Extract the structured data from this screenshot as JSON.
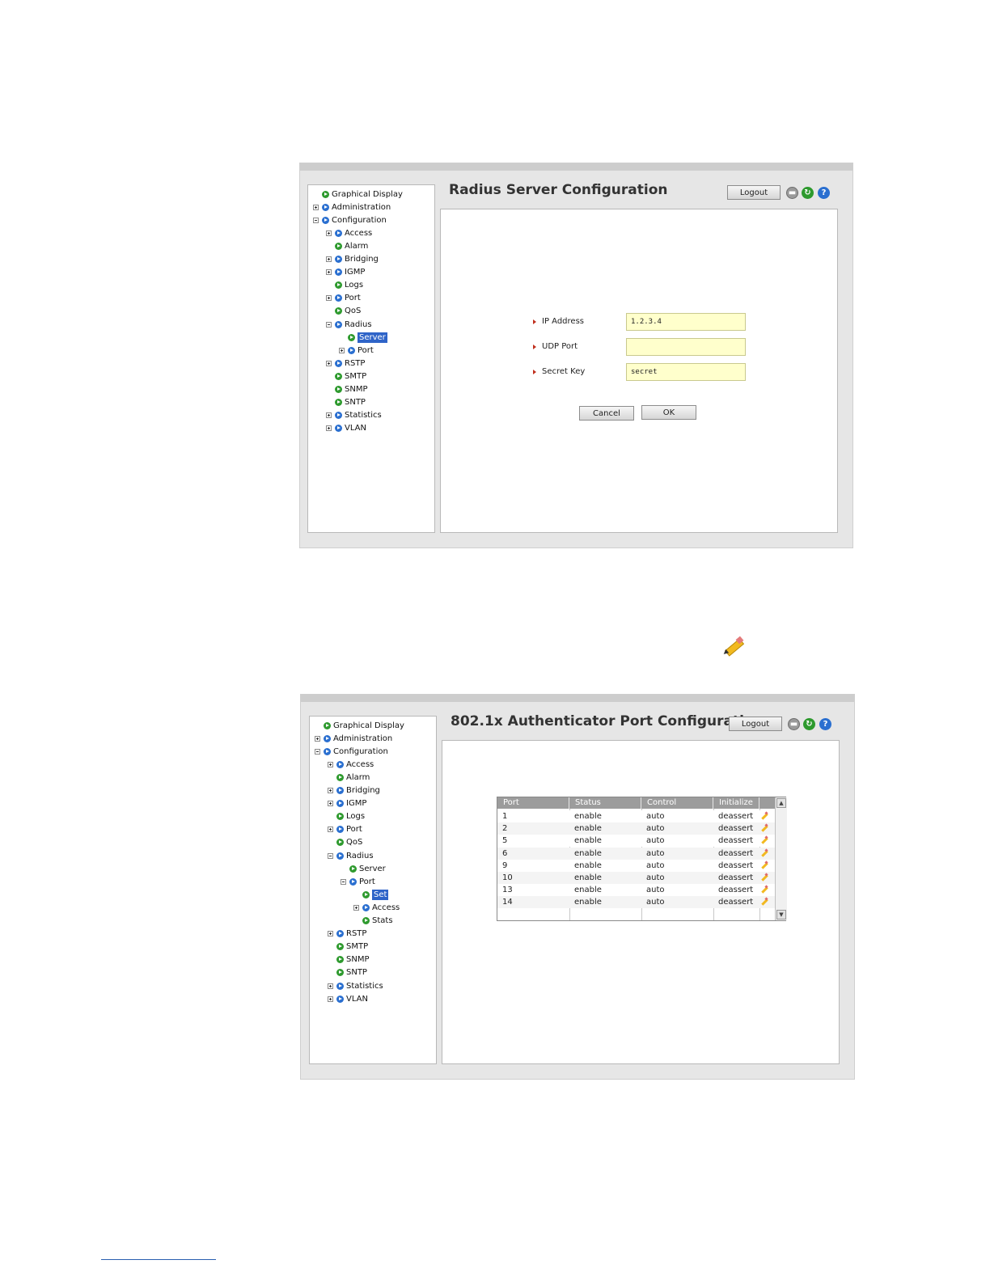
{
  "screen1": {
    "title": "Radius Server Configuration",
    "logout_label": "Logout",
    "tree": [
      {
        "label": "Graphical Display",
        "exp": "",
        "color": "green",
        "level": 0,
        "sel": false
      },
      {
        "label": "Administration",
        "exp": "plus",
        "color": "blue",
        "level": 0,
        "sel": false
      },
      {
        "label": "Configuration",
        "exp": "minus",
        "color": "blue",
        "level": 0,
        "sel": false
      },
      {
        "label": "Access",
        "exp": "plus",
        "color": "blue",
        "level": 1,
        "sel": false
      },
      {
        "label": "Alarm",
        "exp": "",
        "color": "green",
        "level": 1,
        "sel": false
      },
      {
        "label": "Bridging",
        "exp": "plus",
        "color": "blue",
        "level": 1,
        "sel": false
      },
      {
        "label": "IGMP",
        "exp": "plus",
        "color": "blue",
        "level": 1,
        "sel": false
      },
      {
        "label": "Logs",
        "exp": "",
        "color": "green",
        "level": 1,
        "sel": false
      },
      {
        "label": "Port",
        "exp": "plus",
        "color": "blue",
        "level": 1,
        "sel": false
      },
      {
        "label": "QoS",
        "exp": "",
        "color": "green",
        "level": 1,
        "sel": false
      },
      {
        "label": "Radius",
        "exp": "minus",
        "color": "blue",
        "level": 1,
        "sel": false
      },
      {
        "label": "Server",
        "exp": "",
        "color": "green",
        "level": 2,
        "sel": true
      },
      {
        "label": "Port",
        "exp": "plus",
        "color": "blue",
        "level": 2,
        "sel": false
      },
      {
        "label": "RSTP",
        "exp": "plus",
        "color": "blue",
        "level": 1,
        "sel": false
      },
      {
        "label": "SMTP",
        "exp": "",
        "color": "green",
        "level": 1,
        "sel": false
      },
      {
        "label": "SNMP",
        "exp": "",
        "color": "green",
        "level": 1,
        "sel": false
      },
      {
        "label": "SNTP",
        "exp": "",
        "color": "green",
        "level": 1,
        "sel": false
      },
      {
        "label": "Statistics",
        "exp": "plus",
        "color": "blue",
        "level": 1,
        "sel": false
      },
      {
        "label": "VLAN",
        "exp": "plus",
        "color": "blue",
        "level": 1,
        "sel": false
      }
    ],
    "form": {
      "ip_label": "IP Address",
      "ip_value": "1.2.3.4",
      "udp_label": "UDP Port",
      "udp_value": "",
      "key_label": "Secret Key",
      "key_value": "secret",
      "cancel_label": "Cancel",
      "ok_label": "OK"
    }
  },
  "screen2": {
    "title": "802.1x Authenticator Port Configuration",
    "logout_label": "Logout",
    "tree": [
      {
        "label": "Graphical Display",
        "exp": "",
        "color": "green",
        "level": 0,
        "sel": false
      },
      {
        "label": "Administration",
        "exp": "plus",
        "color": "blue",
        "level": 0,
        "sel": false
      },
      {
        "label": "Configuration",
        "exp": "minus",
        "color": "blue",
        "level": 0,
        "sel": false
      },
      {
        "label": "Access",
        "exp": "plus",
        "color": "blue",
        "level": 1,
        "sel": false
      },
      {
        "label": "Alarm",
        "exp": "",
        "color": "green",
        "level": 1,
        "sel": false
      },
      {
        "label": "Bridging",
        "exp": "plus",
        "color": "blue",
        "level": 1,
        "sel": false
      },
      {
        "label": "IGMP",
        "exp": "plus",
        "color": "blue",
        "level": 1,
        "sel": false
      },
      {
        "label": "Logs",
        "exp": "",
        "color": "green",
        "level": 1,
        "sel": false
      },
      {
        "label": "Port",
        "exp": "plus",
        "color": "blue",
        "level": 1,
        "sel": false
      },
      {
        "label": "QoS",
        "exp": "",
        "color": "green",
        "level": 1,
        "sel": false
      },
      {
        "label": "Radius",
        "exp": "minus",
        "color": "blue",
        "level": 1,
        "sel": false
      },
      {
        "label": "Server",
        "exp": "",
        "color": "green",
        "level": 2,
        "sel": false
      },
      {
        "label": "Port",
        "exp": "minus",
        "color": "blue",
        "level": 2,
        "sel": false
      },
      {
        "label": "Set",
        "exp": "",
        "color": "green",
        "level": 3,
        "sel": true
      },
      {
        "label": "Access",
        "exp": "plus",
        "color": "blue",
        "level": 3,
        "sel": false
      },
      {
        "label": "Stats",
        "exp": "",
        "color": "green",
        "level": 3,
        "sel": false
      },
      {
        "label": "RSTP",
        "exp": "plus",
        "color": "blue",
        "level": 1,
        "sel": false
      },
      {
        "label": "SMTP",
        "exp": "",
        "color": "green",
        "level": 1,
        "sel": false
      },
      {
        "label": "SNMP",
        "exp": "",
        "color": "green",
        "level": 1,
        "sel": false
      },
      {
        "label": "SNTP",
        "exp": "",
        "color": "green",
        "level": 1,
        "sel": false
      },
      {
        "label": "Statistics",
        "exp": "plus",
        "color": "blue",
        "level": 1,
        "sel": false
      },
      {
        "label": "VLAN",
        "exp": "plus",
        "color": "blue",
        "level": 1,
        "sel": false
      }
    ],
    "table": {
      "headers": [
        "Port",
        "Status",
        "Control",
        "Initialize"
      ],
      "rows": [
        [
          "1",
          "enable",
          "auto",
          "deassert"
        ],
        [
          "2",
          "enable",
          "auto",
          "deassert"
        ],
        [
          "5",
          "enable",
          "auto",
          "deassert"
        ],
        [
          "6",
          "enable",
          "auto",
          "deassert"
        ],
        [
          "9",
          "enable",
          "auto",
          "deassert"
        ],
        [
          "10",
          "enable",
          "auto",
          "deassert"
        ],
        [
          "13",
          "enable",
          "auto",
          "deassert"
        ],
        [
          "14",
          "enable",
          "auto",
          "deassert"
        ]
      ]
    }
  },
  "colors": {
    "accent": "#2f64c8",
    "input_bg": "#ffffcc",
    "table_header": "#9c9c9c"
  }
}
